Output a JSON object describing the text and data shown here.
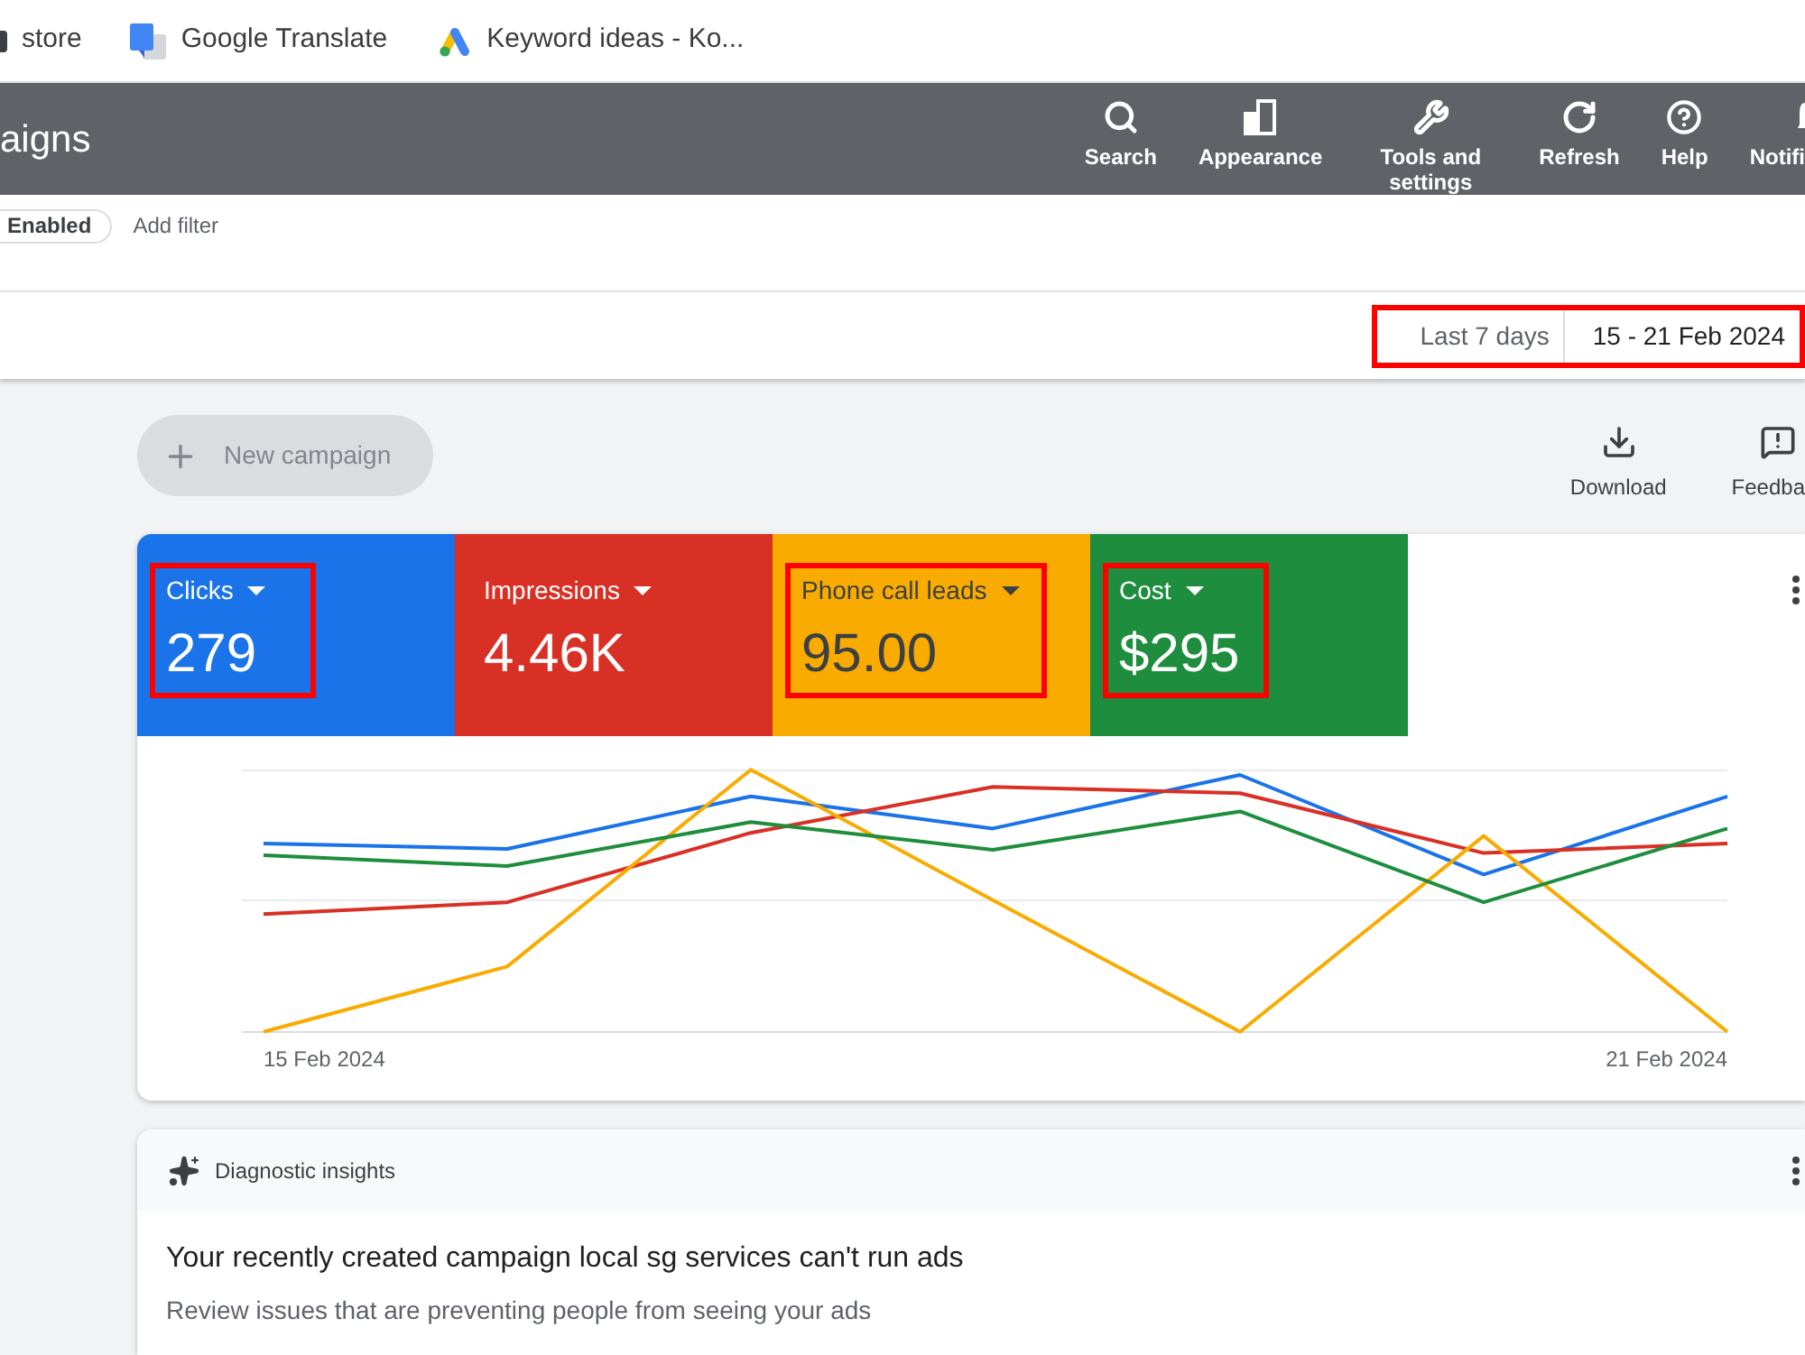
{
  "bookmarks_bar": {
    "items": [
      {
        "label": "store"
      },
      {
        "label": "Google Translate"
      },
      {
        "label": "Keyword ideas - Ko..."
      }
    ]
  },
  "header": {
    "title": "aigns",
    "tools": [
      {
        "label": "Search"
      },
      {
        "label": "Appearance"
      },
      {
        "label": "Tools and settings"
      },
      {
        "label": "Refresh"
      },
      {
        "label": "Help"
      },
      {
        "label": "Notifi"
      }
    ]
  },
  "filter_bar": {
    "chips": [
      {
        "label": "Enabled"
      }
    ],
    "add_filter": "Add filter"
  },
  "date_range": {
    "preset": "Last 7 days",
    "range": "15 - 21 Feb 2024",
    "highlighted": true
  },
  "toolbar": {
    "new_campaign": {
      "label": "New campaign",
      "disabled": true
    },
    "actions": [
      {
        "label": "Download"
      },
      {
        "label": "Feedba"
      }
    ]
  },
  "metrics": [
    {
      "label": "Clicks",
      "value": "279",
      "color": "#1a73e8",
      "highlighted": true
    },
    {
      "label": "Impressions",
      "value": "4.46K",
      "color": "#d93025",
      "highlighted": false
    },
    {
      "label": "Phone call leads",
      "value": "95.00",
      "color": "#f9ab00",
      "highlighted": true
    },
    {
      "label": "Cost",
      "value": "$295",
      "color": "#1e8e3e",
      "highlighted": true
    }
  ],
  "chart": {
    "x_labels": [
      "15 Feb 2024",
      "21 Feb 2024"
    ]
  },
  "insights": {
    "title": "Diagnostic insights",
    "headline": "Your recently created campaign local sg services can't run ads",
    "description": "Review issues that are preventing people from seeing your ads"
  }
}
